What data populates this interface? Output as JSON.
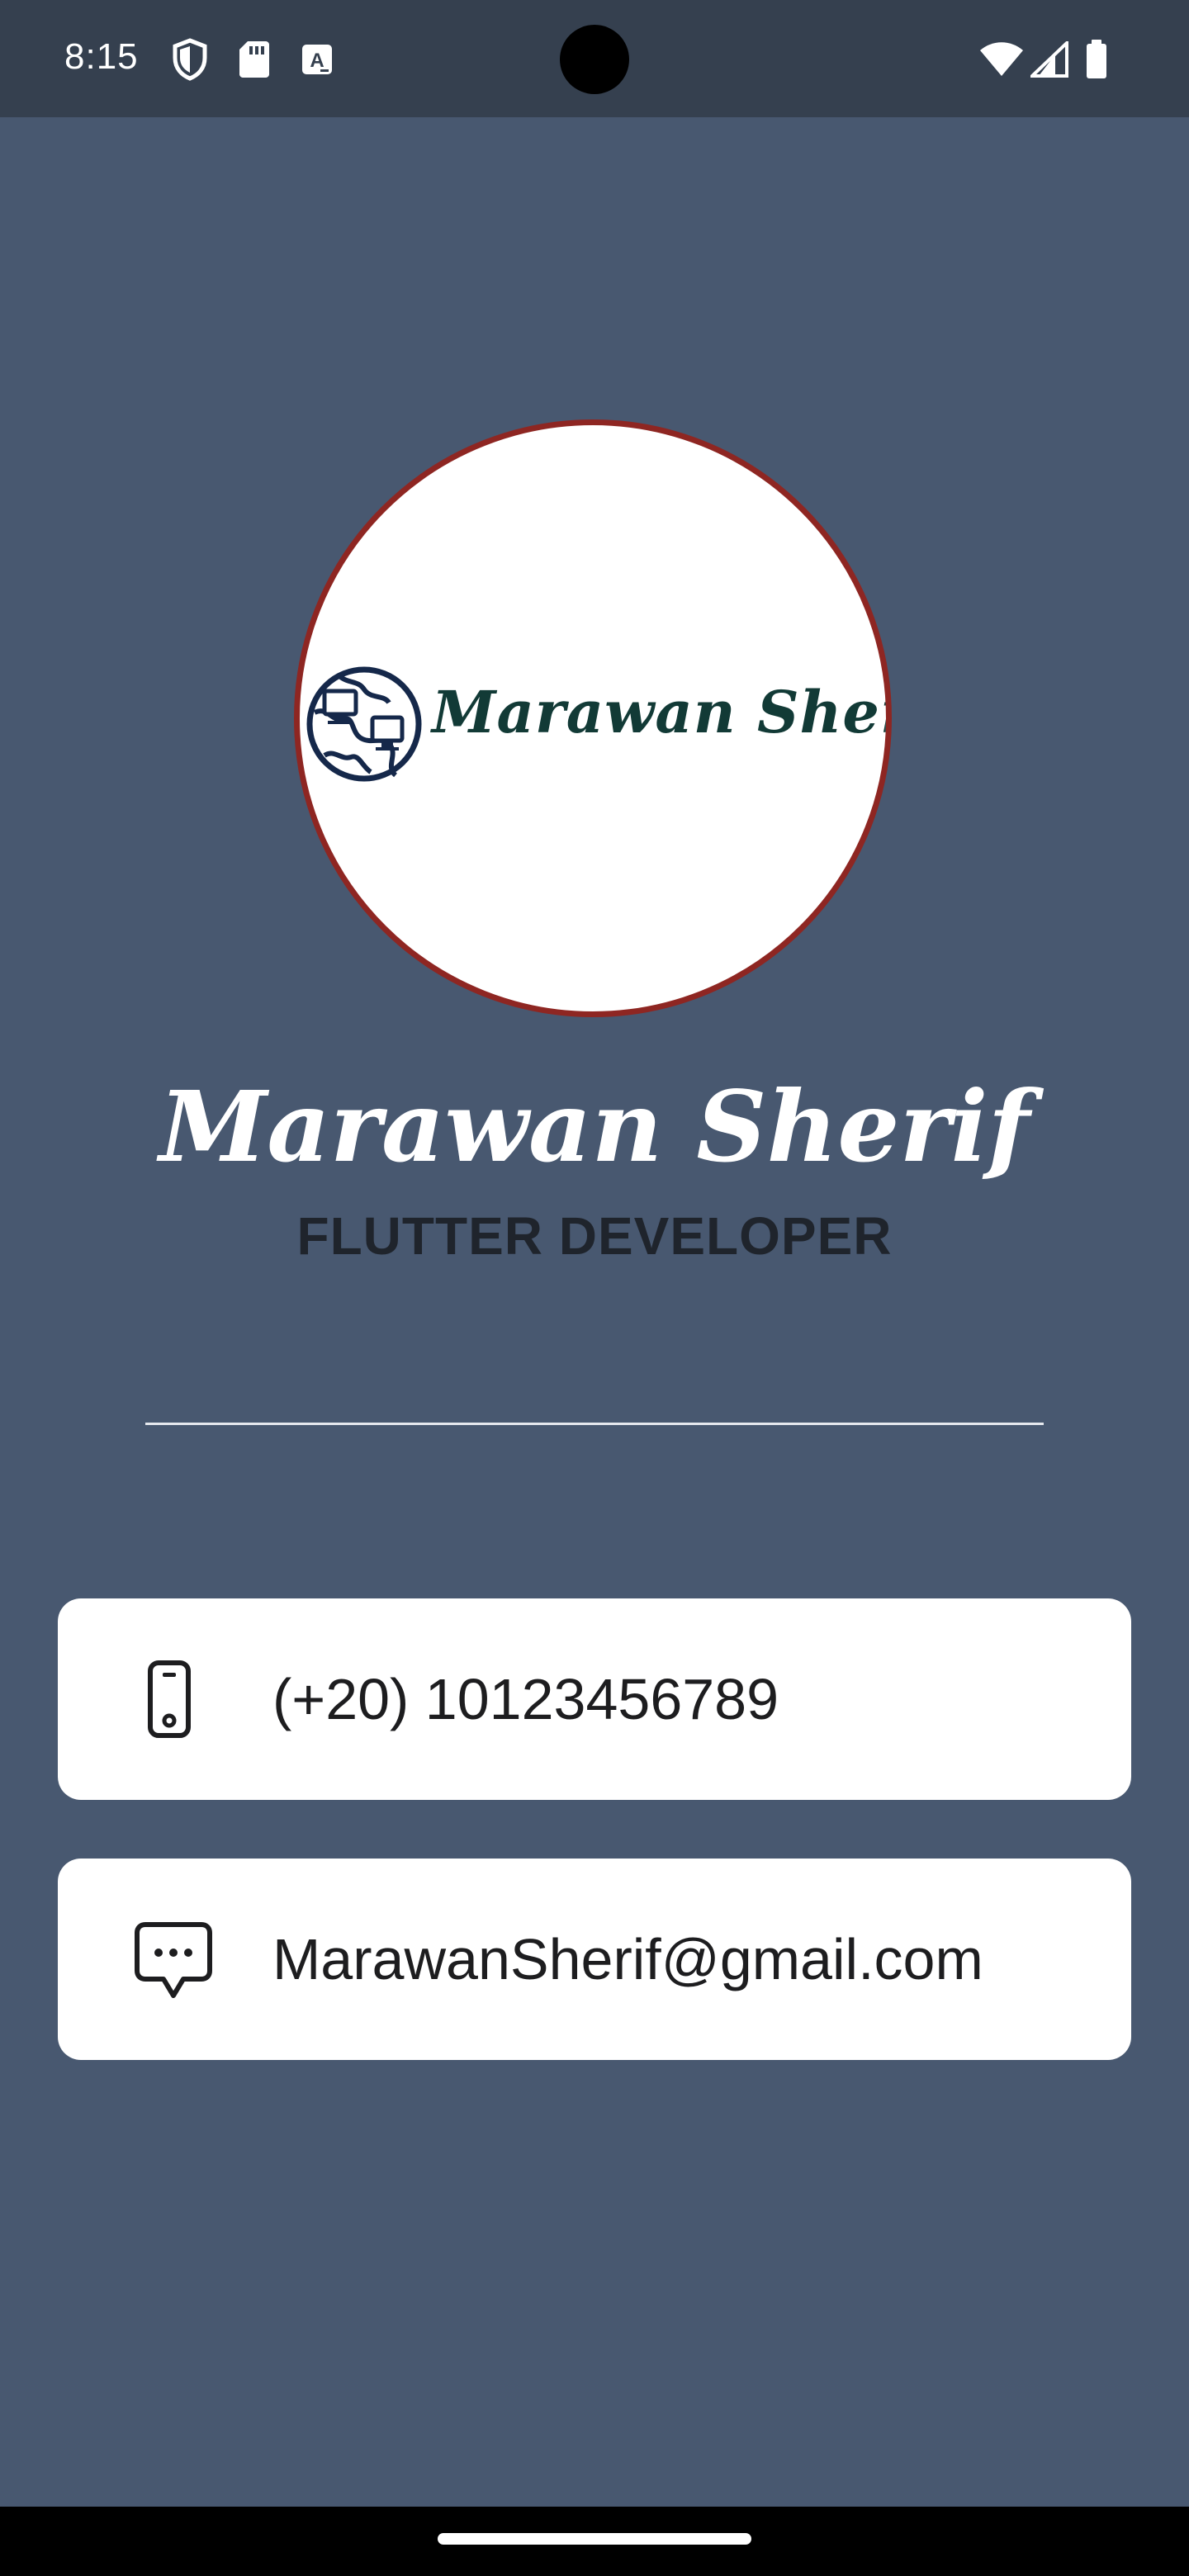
{
  "status_bar": {
    "time": "8:15",
    "icons_left": [
      "shield-icon",
      "sd-card-icon",
      "keyboard-a-icon"
    ],
    "icons_right": [
      "wifi-icon",
      "signal-icon",
      "battery-icon"
    ]
  },
  "profile": {
    "logo_text": "Marawan Sherif",
    "logo_icon": "globe-computers-icon",
    "name": "Marawan Sherif",
    "title": "FLUTTER DEVELOPER"
  },
  "contacts": {
    "phone": {
      "icon": "phone-icon",
      "value": "(+20) 10123456789"
    },
    "email": {
      "icon": "chat-bubble-icon",
      "value": "MarawanSherif@gmail.com"
    }
  },
  "colors": {
    "background": "#485870",
    "status_bar": "#35404f",
    "avatar_border": "#8e2622",
    "logo_text": "#123a36",
    "card": "#ffffff",
    "title_text": "#1f242c"
  }
}
